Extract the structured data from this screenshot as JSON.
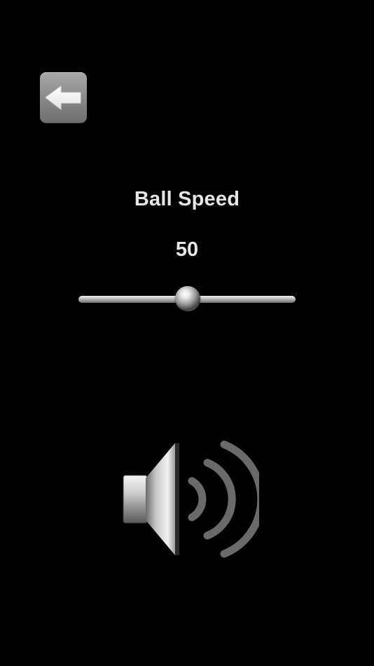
{
  "settings": {
    "title": "Ball Speed",
    "value_text": "50"
  },
  "slider": {
    "min": 0,
    "max": 100,
    "value": 50
  },
  "icons": {
    "back": "arrow-left-icon",
    "sound": "speaker-icon"
  },
  "colors": {
    "background": "#000000",
    "text": "#e6e6e6",
    "button": "#8a8a8a"
  }
}
